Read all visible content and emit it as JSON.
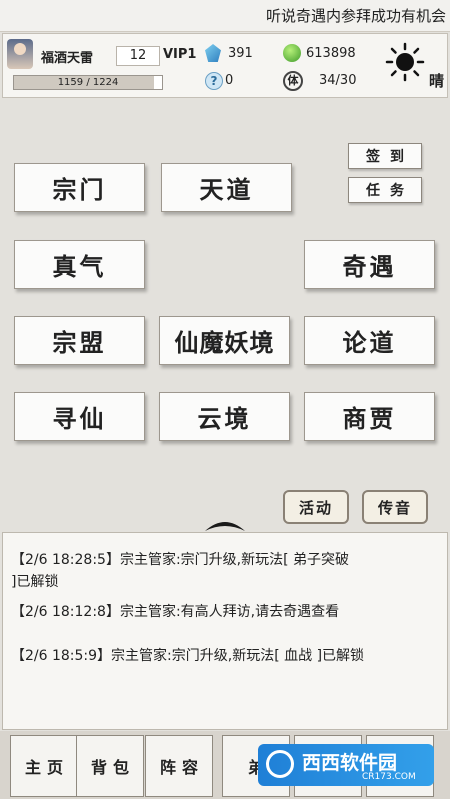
{
  "marquee": {
    "text": "听说奇遇内参拜成功有机会"
  },
  "player": {
    "name": "福酒天雷",
    "level": "12",
    "vip": "VIP1",
    "exp_text": "1159 / 1224",
    "exp_progress": 0.947
  },
  "resources": {
    "gems": "391",
    "coins": "613898",
    "tokens": "0",
    "stamina": "34/30",
    "stamina_icon_text": "体"
  },
  "weather": {
    "label": "晴",
    "icon": "sun-icon"
  },
  "quick_actions": {
    "sign_in": "签到",
    "tasks": "任务"
  },
  "main_buttons": {
    "sect": "宗门",
    "heaven_dao": "天道",
    "true_qi": "真气",
    "encounter": "奇遇",
    "alliance": "宗盟",
    "demon_realm": "仙魔妖境",
    "debate": "论道",
    "seek_immortal": "寻仙",
    "cloud_realm": "云境",
    "merchant": "商贾"
  },
  "side_actions": {
    "activity": "活动",
    "broadcast": "传音"
  },
  "log": [
    {
      "line1": "【2/6 18:28:5】宗主管家:宗门升级,新玩法[ 弟子突破",
      "line2": "]已解锁"
    },
    {
      "line1": "【2/6 18:12:8】宗主管家:有高人拜访,请去奇遇查看",
      "line2": ""
    },
    {
      "line1": "【2/6 18:5:9】宗主管家:宗门升级,新玩法[ 血战 ]已解锁",
      "line2": ""
    }
  ],
  "tabs": {
    "home": "主页",
    "bag": "背包",
    "formation": "阵容",
    "disciple": "弟"
  },
  "watermark": {
    "brand": "西西软件园",
    "url": "CR173.COM"
  },
  "colors": {
    "background": "#e3e1dc",
    "button_face": "#fbfbfa",
    "gem": "#2f7fbf",
    "coin": "#3f9a2a"
  }
}
